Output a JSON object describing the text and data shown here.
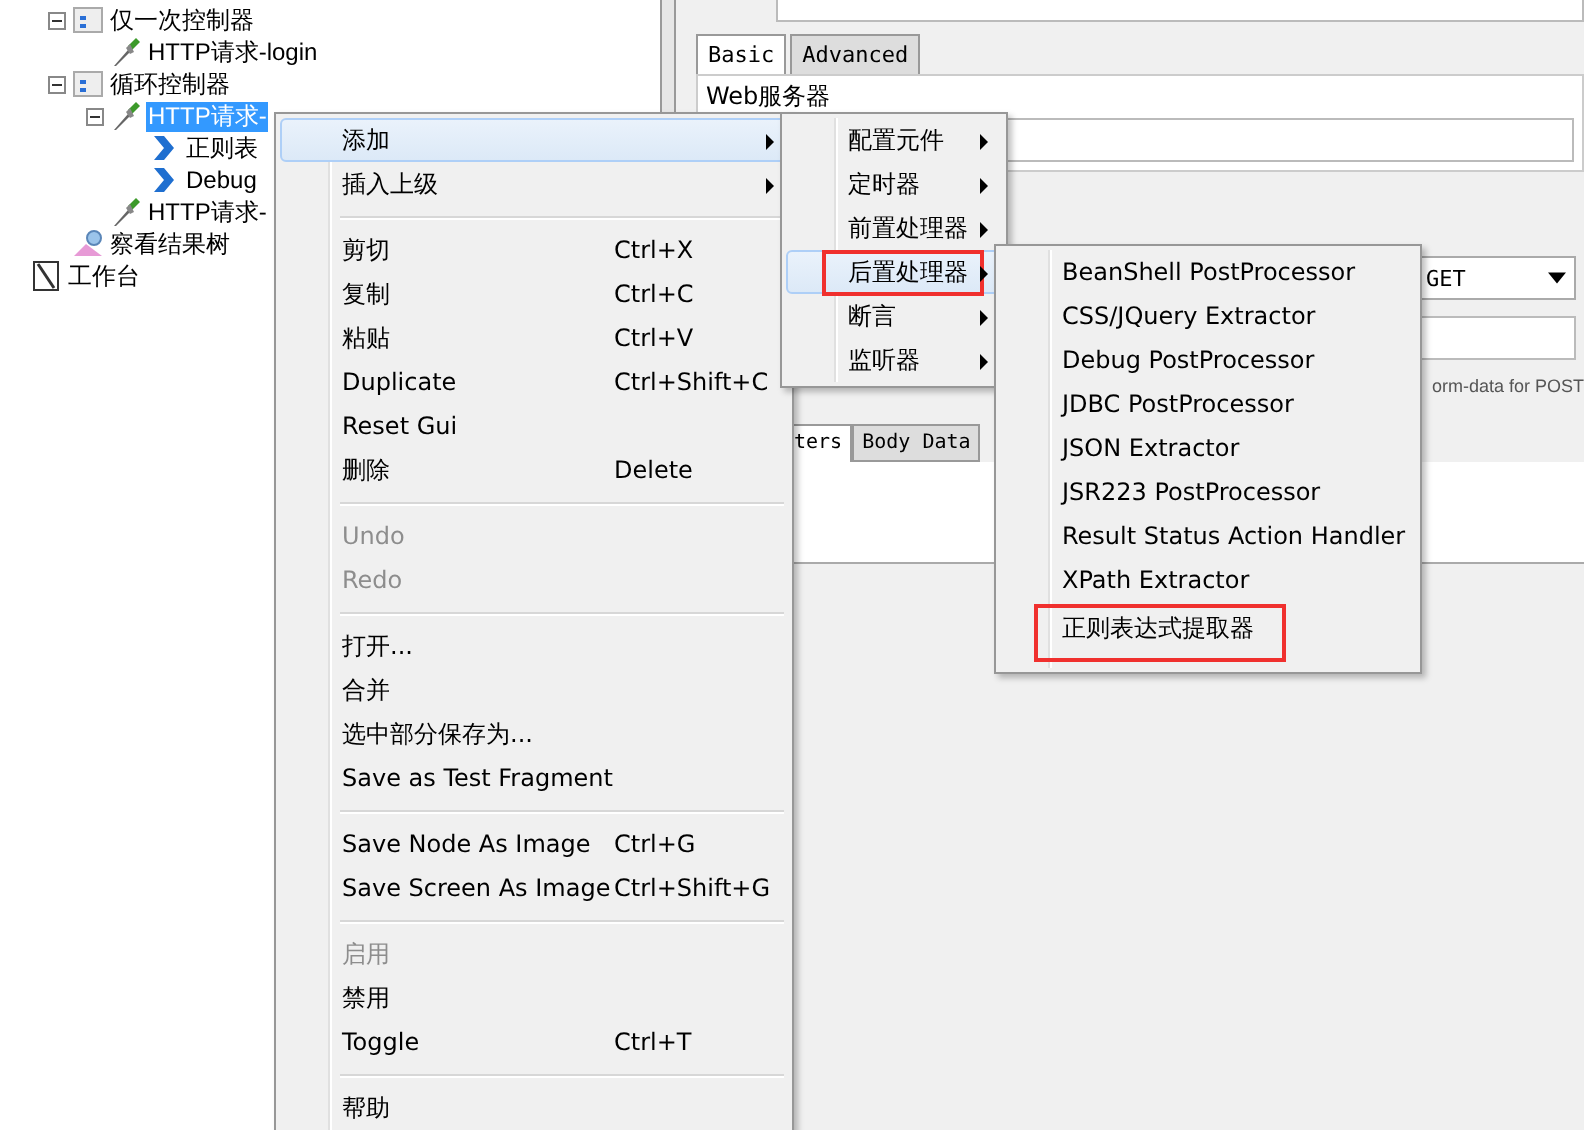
{
  "tree": {
    "items": [
      {
        "label": "仅一次控制器",
        "kind": "controller",
        "expanded": true,
        "selected": false,
        "children": [
          {
            "label": "HTTP请求-login",
            "kind": "sampler",
            "selected": false
          }
        ]
      },
      {
        "label": "循环控制器",
        "kind": "controller",
        "expanded": true,
        "selected": false,
        "children": [
          {
            "label": "HTTP请求-",
            "kind": "sampler",
            "expanded": true,
            "selected": true,
            "children": [
              {
                "label": "正则表",
                "kind": "extractor",
                "selected": false
              },
              {
                "label": "Debug",
                "kind": "extractor",
                "selected": false
              }
            ]
          },
          {
            "label": "HTTP请求-",
            "kind": "sampler",
            "selected": false
          }
        ]
      },
      {
        "label": "察看结果树",
        "kind": "listener",
        "selected": false
      }
    ],
    "workbench": {
      "label": "工作台",
      "kind": "workbench",
      "selected": false
    }
  },
  "panel": {
    "tabs": [
      {
        "label": "Basic",
        "selected": true
      },
      {
        "label": "Advanced",
        "selected": false
      }
    ],
    "group_title": "Web服务器",
    "method": "GET",
    "multipart_hint": "orm-data for POST",
    "lower_tabs": [
      {
        "label": "ters",
        "selected": true
      },
      {
        "label": "Body Data",
        "selected": false
      }
    ]
  },
  "context_menu": [
    {
      "kind": "item",
      "label": "添加",
      "submenu": true,
      "selected": true,
      "disabled": false
    },
    {
      "kind": "item",
      "label": "插入上级",
      "submenu": true,
      "selected": false,
      "disabled": false
    },
    {
      "kind": "separator"
    },
    {
      "kind": "item",
      "label": "剪切",
      "shortcut": "Ctrl+X",
      "submenu": false,
      "selected": false,
      "disabled": false
    },
    {
      "kind": "item",
      "label": "复制",
      "shortcut": "Ctrl+C",
      "submenu": false,
      "selected": false,
      "disabled": false
    },
    {
      "kind": "item",
      "label": "粘贴",
      "shortcut": "Ctrl+V",
      "submenu": false,
      "selected": false,
      "disabled": false
    },
    {
      "kind": "item",
      "label": "Duplicate",
      "shortcut": "Ctrl+Shift+C",
      "submenu": false,
      "selected": false,
      "disabled": false
    },
    {
      "kind": "item",
      "label": "Reset Gui",
      "submenu": false,
      "selected": false,
      "disabled": false
    },
    {
      "kind": "item",
      "label": "删除",
      "shortcut": "Delete",
      "submenu": false,
      "selected": false,
      "disabled": false
    },
    {
      "kind": "separator"
    },
    {
      "kind": "item",
      "label": "Undo",
      "submenu": false,
      "selected": false,
      "disabled": true
    },
    {
      "kind": "item",
      "label": "Redo",
      "submenu": false,
      "selected": false,
      "disabled": true
    },
    {
      "kind": "separator"
    },
    {
      "kind": "item",
      "label": "打开...",
      "submenu": false,
      "selected": false,
      "disabled": false
    },
    {
      "kind": "item",
      "label": "合并",
      "submenu": false,
      "selected": false,
      "disabled": false
    },
    {
      "kind": "item",
      "label": "选中部分保存为...",
      "submenu": false,
      "selected": false,
      "disabled": false
    },
    {
      "kind": "item",
      "label": "Save as Test Fragment",
      "submenu": false,
      "selected": false,
      "disabled": false
    },
    {
      "kind": "separator"
    },
    {
      "kind": "item",
      "label": "Save Node As Image",
      "shortcut": "Ctrl+G",
      "submenu": false,
      "selected": false,
      "disabled": false
    },
    {
      "kind": "item",
      "label": "Save Screen As Image",
      "shortcut": "Ctrl+Shift+G",
      "submenu": false,
      "selected": false,
      "disabled": false
    },
    {
      "kind": "separator"
    },
    {
      "kind": "item",
      "label": "启用",
      "submenu": false,
      "selected": false,
      "disabled": true
    },
    {
      "kind": "item",
      "label": "禁用",
      "submenu": false,
      "selected": false,
      "disabled": false
    },
    {
      "kind": "item",
      "label": "Toggle",
      "shortcut": "Ctrl+T",
      "submenu": false,
      "selected": false,
      "disabled": false
    },
    {
      "kind": "separator"
    },
    {
      "kind": "item",
      "label": "帮助",
      "submenu": false,
      "selected": false,
      "disabled": false
    }
  ],
  "add_submenu": [
    {
      "label": "配置元件",
      "submenu": true,
      "selected": false,
      "highlighted": false
    },
    {
      "label": "定时器",
      "submenu": true,
      "selected": false,
      "highlighted": false
    },
    {
      "label": "前置处理器",
      "submenu": true,
      "selected": false,
      "highlighted": false
    },
    {
      "label": "后置处理器",
      "submenu": true,
      "selected": true,
      "highlighted": true
    },
    {
      "label": "断言",
      "submenu": true,
      "selected": false,
      "highlighted": false
    },
    {
      "label": "监听器",
      "submenu": true,
      "selected": false,
      "highlighted": false
    }
  ],
  "post_processor_submenu": [
    {
      "label": "BeanShell PostProcessor",
      "highlighted": false
    },
    {
      "label": "CSS/JQuery Extractor",
      "highlighted": false
    },
    {
      "label": "Debug PostProcessor",
      "highlighted": false
    },
    {
      "label": "JDBC PostProcessor",
      "highlighted": false
    },
    {
      "label": "JSON Extractor",
      "highlighted": false
    },
    {
      "label": "JSR223 PostProcessor",
      "highlighted": false
    },
    {
      "label": "Result Status Action Handler",
      "highlighted": false
    },
    {
      "label": "XPath Extractor",
      "highlighted": false
    },
    {
      "label": "正则表达式提取器",
      "highlighted": true
    }
  ]
}
